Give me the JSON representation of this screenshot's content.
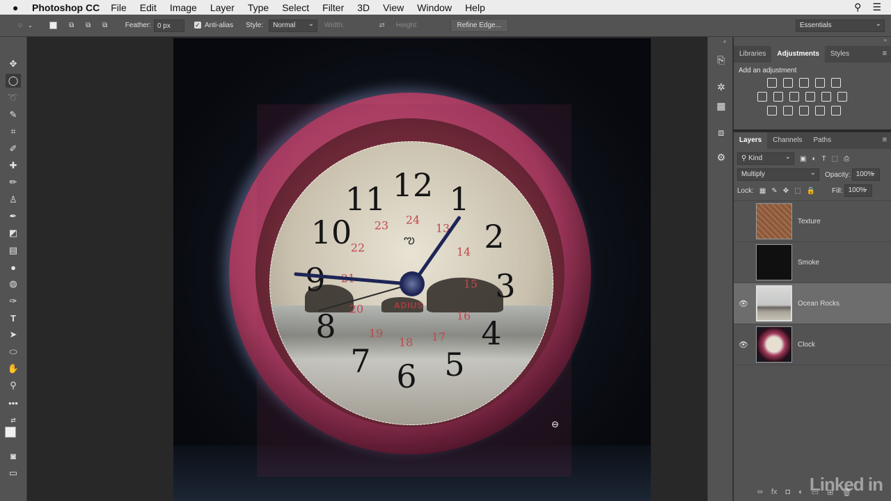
{
  "menubar": {
    "app_name": "Photoshop CC",
    "items": [
      "File",
      "Edit",
      "Image",
      "Layer",
      "Type",
      "Select",
      "Filter",
      "3D",
      "View",
      "Window",
      "Help"
    ]
  },
  "options": {
    "feather_label": "Feather:",
    "feather_value": "0 px",
    "antialias_label": "Anti-alias",
    "style_label": "Style:",
    "style_value": "Normal",
    "width_label": "Width:",
    "height_label": "Height:",
    "refine_edge": "Refine Edge...",
    "workspace": "Essentials"
  },
  "adjust_panel": {
    "tabs": [
      "Libraries",
      "Adjustments",
      "Styles"
    ],
    "title": "Add an adjustment"
  },
  "layers_panel": {
    "tabs": [
      "Layers",
      "Channels",
      "Paths"
    ],
    "kind_filter": "Kind",
    "blend_mode": "Multiply",
    "opacity_label": "Opacity:",
    "opacity_value": "100%",
    "lock_label": "Lock:",
    "fill_label": "Fill:",
    "fill_value": "100%",
    "layers": [
      {
        "name": "Texture",
        "visible": false,
        "selected": false
      },
      {
        "name": "Smoke",
        "visible": false,
        "selected": false
      },
      {
        "name": "Ocean Rocks",
        "visible": true,
        "selected": true
      },
      {
        "name": "Clock",
        "visible": true,
        "selected": false
      }
    ]
  },
  "clock_face": {
    "hours": [
      "12",
      "1",
      "2",
      "3",
      "4",
      "5",
      "6",
      "7",
      "8",
      "9",
      "10",
      "11"
    ],
    "red_numbers": [
      "24",
      "13",
      "14",
      "15",
      "16",
      "17",
      "18",
      "19",
      "20",
      "21",
      "22",
      "23"
    ],
    "brand": "ADIUS"
  },
  "watermark": "Linked in",
  "colors": {
    "panel_bg": "#535353",
    "canvas_bg": "#282828",
    "clock_rim": "#a33a5e"
  }
}
